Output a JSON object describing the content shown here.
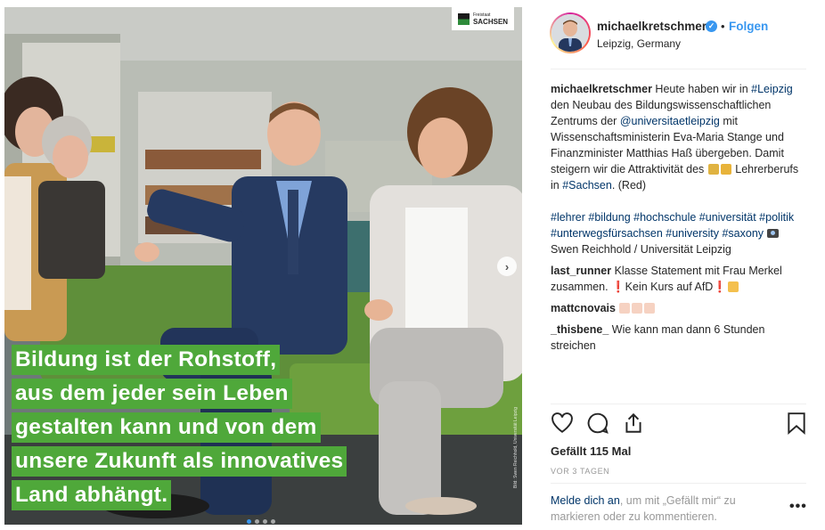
{
  "photo": {
    "logo_small": "Freistaat",
    "logo_main": "SACHSEN",
    "quote_lines": [
      "Bildung ist der Rohstoff,",
      "aus dem jeder sein Leben",
      "gestalten kann und von dem",
      "unsere Zukunft als innovatives",
      "Land abhängt."
    ],
    "credit": "Bild: Swen Reichhold, Universität Leipzig",
    "next_arrow": "›"
  },
  "post": {
    "username": "michaelkretschmer",
    "verified_mark": "✓",
    "separator": "•",
    "follow_label": "Folgen",
    "location": "Leipzig, Germany",
    "caption": {
      "t1": " Heute haben wir in ",
      "tag_leipzig": "#Leipzig",
      "t2": " den Neubau des Bildungswissenschaftlichen Zentrums der ",
      "mention_uni": "@universitaetleipzig",
      "t3": " mit Wissenschaftsministerin Eva-Maria Stange und Finanzminister Matthias Haß übergeben. Damit steigern wir die Attraktivität des ",
      "t4": " Lehrerberufs in ",
      "tag_sachsen": "#Sachsen",
      "t5": ". (Red)"
    },
    "hashtags": {
      "tags": "#lehrer #bildung #hochschule #universität #politik #unterwegsfürsachsen #university #saxony",
      "credit_text": " Swen Reichhold / Universität Leipzig"
    },
    "comments": [
      {
        "user": "last_runner",
        "text1": " Klasse Statement mit Frau Merkel zusammen. ",
        "excl1": "❗",
        "text2": "Kein Kurs auf AfD",
        "excl2": "❗"
      },
      {
        "user": "mattcnovais",
        "text": ""
      },
      {
        "user": "_thisbene_",
        "text": " Wie kann man dann 6 Stunden streichen"
      }
    ],
    "likes": "Gefällt 115 Mal",
    "time_ago": "VOR 3 TAGEN",
    "login_link": "Melde dich an",
    "login_text": ", um mit „Gefällt mir“ zu markieren oder zu kommentieren.",
    "more_label": "•••"
  },
  "icons": [
    "heart-icon",
    "comment-icon",
    "share-icon",
    "bookmark-icon",
    "camera-icon",
    "teacher-emoji-icon",
    "clap-emoji-icon"
  ],
  "colors": {
    "accent": "#3897f0",
    "link": "#003569",
    "quote_bg": "#4fa83a",
    "muted": "#999999"
  }
}
